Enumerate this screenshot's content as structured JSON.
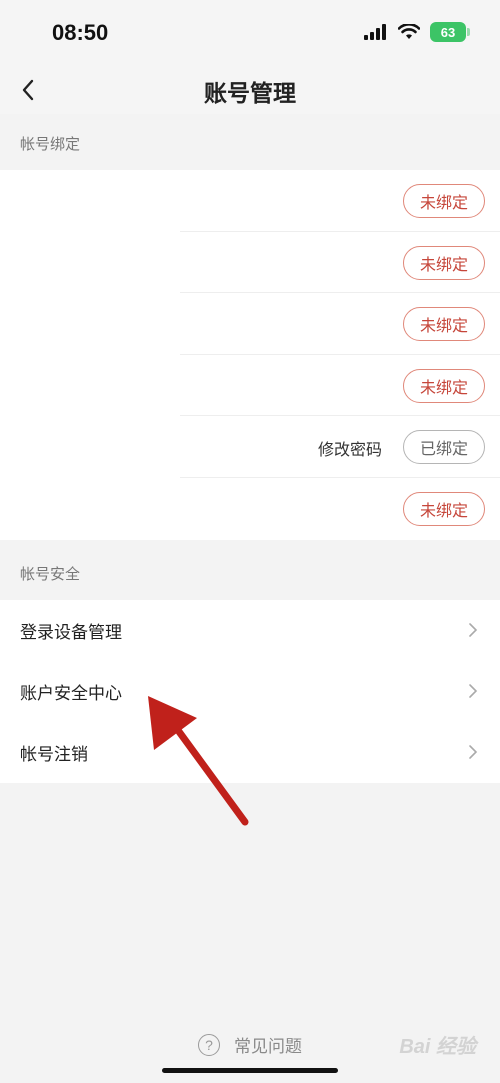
{
  "status_bar": {
    "time": "08:50",
    "battery": "63"
  },
  "nav": {
    "title": "账号管理"
  },
  "sections": {
    "binding_header": "帐号绑定",
    "security_header": "帐号安全"
  },
  "binding_rows": [
    {
      "label": "",
      "status": "未绑定",
      "state": "unbound"
    },
    {
      "label": "",
      "status": "未绑定",
      "state": "unbound"
    },
    {
      "label": "",
      "status": "未绑定",
      "state": "unbound"
    },
    {
      "label": "",
      "status": "未绑定",
      "state": "unbound"
    },
    {
      "label": "修改密码",
      "status": "已绑定",
      "state": "bound"
    },
    {
      "label": "",
      "status": "未绑定",
      "state": "unbound"
    }
  ],
  "security_rows": [
    {
      "label": "登录设备管理"
    },
    {
      "label": "账户安全中心"
    },
    {
      "label": "帐号注销"
    }
  ],
  "footer": {
    "faq_label": "常见问题",
    "faq_icon": "question-circle-icon",
    "watermark": "Bai 经验"
  },
  "colors": {
    "unbound_accent": "#c6463a",
    "arrow": "#c0211b"
  }
}
